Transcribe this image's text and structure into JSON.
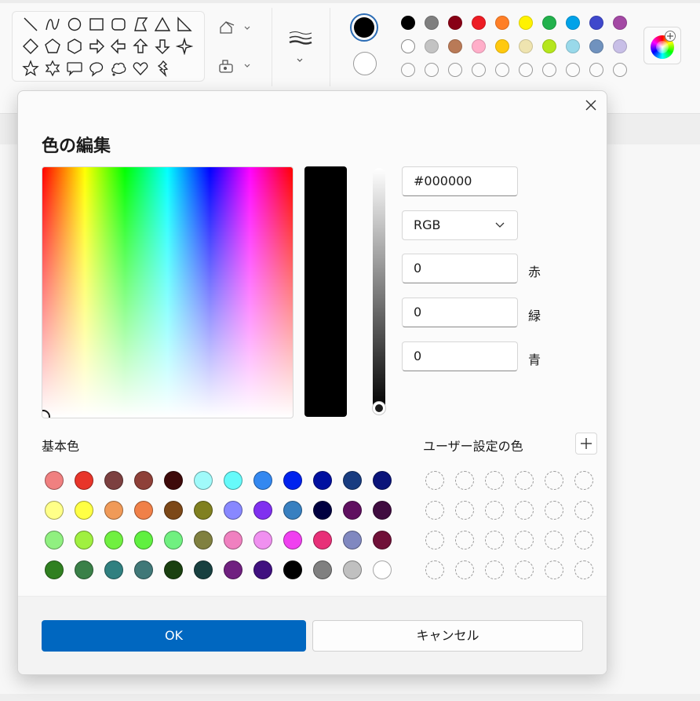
{
  "dialog": {
    "title": "色の編集",
    "hex_value": "#000000",
    "mode_value": "RGB",
    "red_value": "0",
    "green_value": "0",
    "blue_value": "0",
    "red_label": "赤",
    "green_label": "緑",
    "blue_label": "青",
    "basic_colors_label": "基本色",
    "custom_colors_label": "ユーザー設定の色",
    "ok_label": "OK",
    "cancel_label": "キャンセル",
    "preview_color": "#000000",
    "basic_colors": [
      [
        "#f08080",
        "#e8352a",
        "#7c4040",
        "#8e4038",
        "#3e0a0a",
        "#a0fafa",
        "#66fafa",
        "#3388f0",
        "#0022ee",
        "#0010a0",
        "#183c80",
        "#0a147a"
      ],
      [
        "#ffff88",
        "#ffff44",
        "#f09a58",
        "#f08048",
        "#7c4818",
        "#808020",
        "#8888ff",
        "#8030f0",
        "#3880c0",
        "#000040",
        "#601060",
        "#400c40"
      ],
      [
        "#90f080",
        "#a0f040",
        "#70f040",
        "#60f040",
        "#70f080",
        "#808040",
        "#f080c0",
        "#f090f0",
        "#f040f0",
        "#e83078",
        "#8088c0",
        "#701038"
      ],
      [
        "#308020",
        "#3a8048",
        "#308080",
        "#407878",
        "#1a4010",
        "#184040",
        "#702080",
        "#401080",
        "#000000",
        "#808080",
        "#c0c0c0",
        "#ffffff"
      ]
    ],
    "custom_colors_count": 24
  },
  "ribbon": {
    "primary_color": "#000000",
    "secondary_color": "#ffffff",
    "palette": [
      [
        "#000000",
        "#7f7f7f",
        "#880015",
        "#ed1c24",
        "#ff7f27",
        "#fff200",
        "#22b14c",
        "#00a2e8",
        "#3f48cc",
        "#a349a4"
      ],
      [
        "#ffffff",
        "#c3c3c3",
        "#b97a57",
        "#ffaec9",
        "#ffc90e",
        "#efe4b0",
        "#b5e61d",
        "#99d9ea",
        "#7092be",
        "#c8bfe7"
      ]
    ],
    "empty_slots": 10
  }
}
